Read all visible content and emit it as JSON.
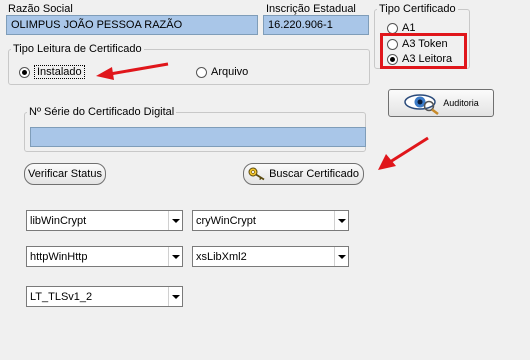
{
  "razao_social": {
    "label": "Razão Social",
    "value": "OLIMPUS JOÃO PESSOA RAZÃO"
  },
  "inscricao_estadual": {
    "label": "Inscrição Estadual",
    "value": "16.220.906-1"
  },
  "tipo_certificado": {
    "legend": "Tipo Certificado",
    "options": [
      "A1",
      "A3 Token",
      "A3 Leitora"
    ],
    "selected": "A3 Leitora"
  },
  "tipo_leitura": {
    "legend": "Tipo Leitura de Certificado",
    "options": [
      "Instalado",
      "Arquivo"
    ],
    "selected": "Instalado"
  },
  "auditoria_button": {
    "label": "Auditoria",
    "icon": "eye-magnifier-icon"
  },
  "serie_certificado": {
    "legend": "Nº Série do Certificado Digital",
    "value": ""
  },
  "verificar_status_button": {
    "label": "Verificar Status"
  },
  "buscar_certificado_button": {
    "label": "Buscar Certificado",
    "icon": "key-icon"
  },
  "combos": {
    "ssl_lib": "libWinCrypt",
    "crypt_lib": "cryWinCrypt",
    "http_lib": "httpWinHttp",
    "xmlsign_lib": "xsLibXml2",
    "ssl_type": "LT_TLSv1_2"
  },
  "annotations": {
    "arrow_color": "#e0161b",
    "highlight_color": "#e0161b"
  }
}
